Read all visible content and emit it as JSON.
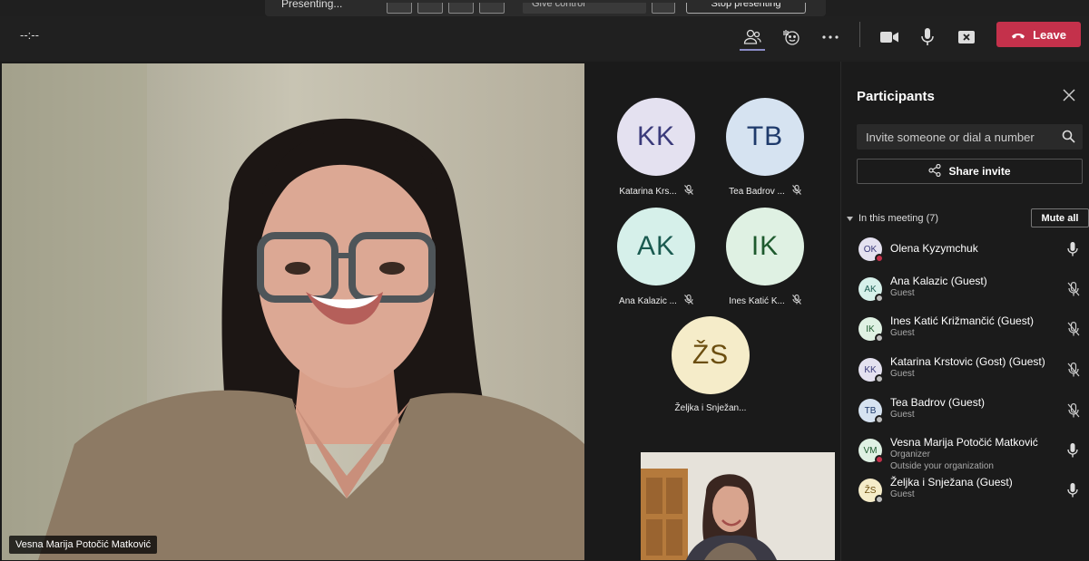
{
  "presenting_bar": {
    "label": "Presenting...",
    "give_control_label": "Give control",
    "stop_label": "Stop presenting"
  },
  "toolbar": {
    "timer": "--:--",
    "leave_label": "Leave"
  },
  "main_video": {
    "name": "Vesna Marija Potočić Matković"
  },
  "tiles": [
    {
      "initials": "KK",
      "name": "Katarina Krs...",
      "bg": "#e4e1f0",
      "fg": "#3a3a7a"
    },
    {
      "initials": "TB",
      "name": "Tea Badrov ...",
      "bg": "#d6e3f1",
      "fg": "#1e3a6b"
    },
    {
      "initials": "AK",
      "name": "Ana Kalazic ...",
      "bg": "#d6f0ea",
      "fg": "#1a5a50"
    },
    {
      "initials": "IK",
      "name": "Ines Katić K...",
      "bg": "#dff1e3",
      "fg": "#1e5a2e"
    },
    {
      "initials": "ŽS",
      "name": "Željka i Snježan...",
      "bg": "#f5ecc9",
      "fg": "#6b4e10"
    }
  ],
  "panel": {
    "title": "Participants",
    "search_placeholder": "Invite someone or dial a number",
    "share_label": "Share invite",
    "section_label": "In this meeting (7)",
    "mute_all_label": "Mute all",
    "participants": [
      {
        "initials": "OK",
        "name": "Olena Kyzymchuk",
        "sub1": "",
        "sub2": "",
        "bg": "#e4e1f0",
        "fg": "#3a3a7a",
        "status": "#c4314b",
        "muted": false
      },
      {
        "initials": "AK",
        "name": "Ana Kalazic (Guest)",
        "sub1": "Guest",
        "sub2": "",
        "bg": "#d6f0ea",
        "fg": "#1a5a50",
        "status": "#bdbdbd",
        "muted": true
      },
      {
        "initials": "IK",
        "name": "Ines Katić Križmančić (Guest)",
        "sub1": "Guest",
        "sub2": "",
        "bg": "#dff1e3",
        "fg": "#1e5a2e",
        "status": "#bdbdbd",
        "muted": true
      },
      {
        "initials": "KK",
        "name": "Katarina Krstovic (Gost) (Guest)",
        "sub1": "Guest",
        "sub2": "",
        "bg": "#e4e1f0",
        "fg": "#3a3a7a",
        "status": "#bdbdbd",
        "muted": true
      },
      {
        "initials": "TB",
        "name": "Tea Badrov (Guest)",
        "sub1": "Guest",
        "sub2": "",
        "bg": "#d6e3f1",
        "fg": "#1e3a6b",
        "status": "#bdbdbd",
        "muted": true
      },
      {
        "initials": "VM",
        "name": "Vesna Marija Potočić Matković",
        "sub1": "Organizer",
        "sub2": "Outside your organization",
        "bg": "#dff1e3",
        "fg": "#1e5a2e",
        "status": "#c4314b",
        "muted": false
      },
      {
        "initials": "ŽS",
        "name": "Željka i Snježana (Guest)",
        "sub1": "Guest",
        "sub2": "",
        "bg": "#f5ecc9",
        "fg": "#6b4e10",
        "status": "#bdbdbd",
        "muted": false
      }
    ]
  },
  "icons": {
    "people": "people-icon",
    "reactions": "reactions-icon",
    "more": "more-icon",
    "camera": "camera-icon",
    "mic": "mic-icon",
    "share": "share-tray-icon",
    "leave": "phone-hangup-icon"
  }
}
